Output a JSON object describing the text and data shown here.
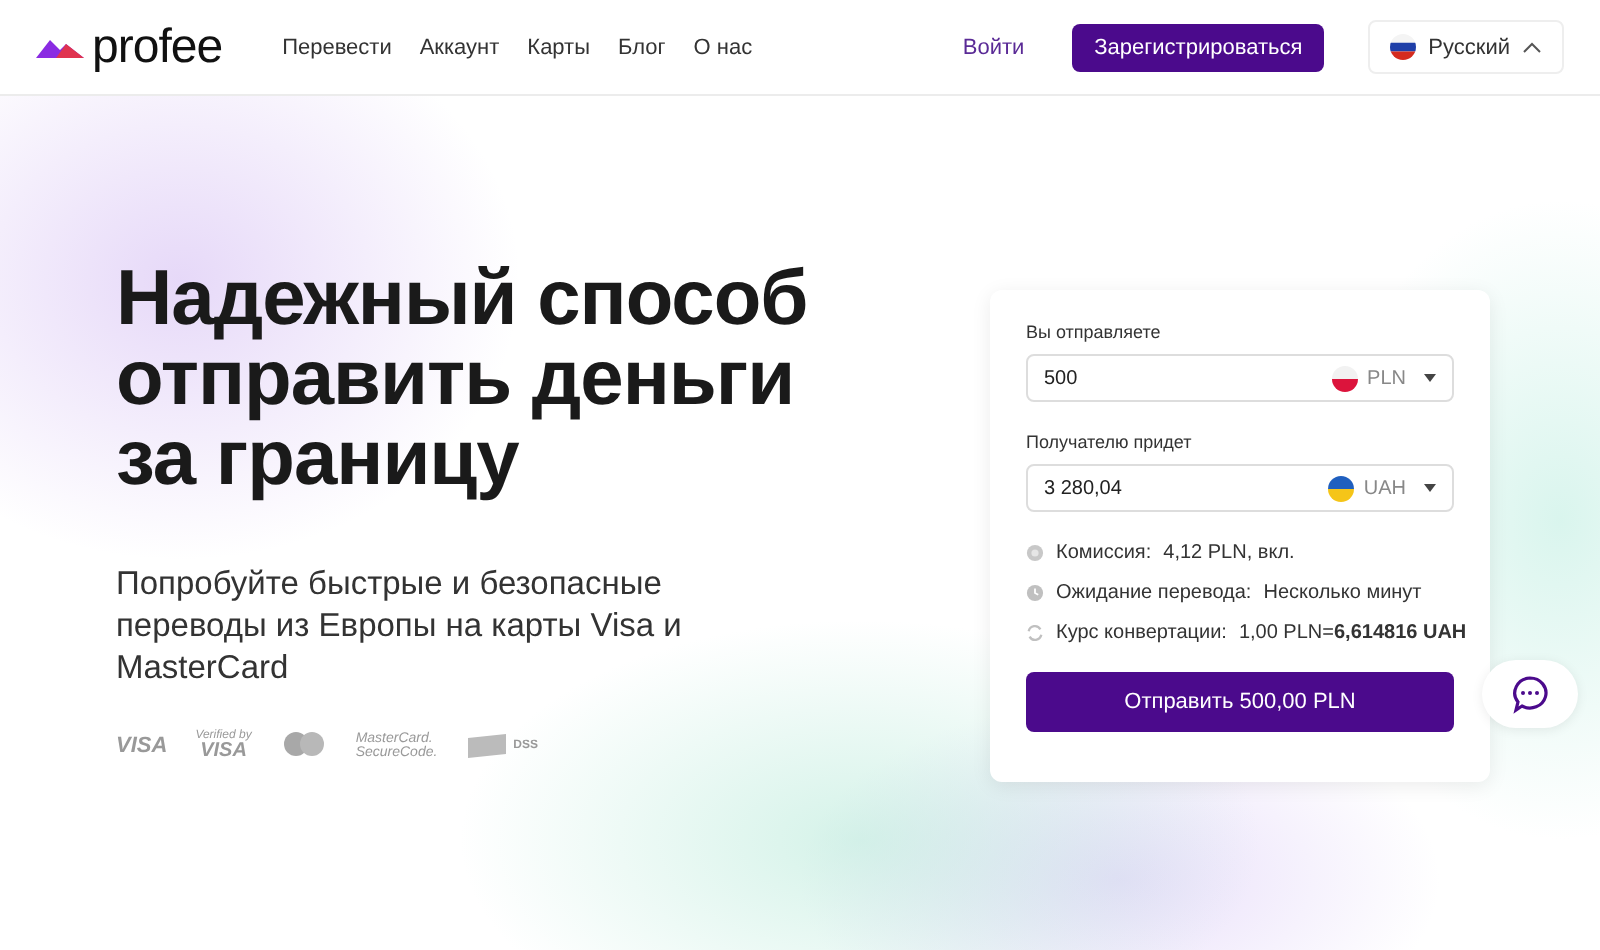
{
  "header": {
    "logo": "profee",
    "nav": [
      "Перевести",
      "Аккаунт",
      "Карты",
      "Блог",
      "О нас"
    ],
    "login": "Войти",
    "signup": "Зарегистрироваться",
    "language": {
      "label": "Русский",
      "expanded": true
    }
  },
  "hero": {
    "title_lines": [
      "Надежный способ",
      "отправить деньги",
      "за границу"
    ],
    "subtitle": "Попробуйте быстрые и безопасные переводы из Европы на карты Visa и MasterCard",
    "badges": [
      {
        "kind": "visa",
        "lines": [
          "VISA"
        ]
      },
      {
        "kind": "verified",
        "lines": [
          "Verified by",
          "VISA"
        ]
      },
      {
        "kind": "mastercard"
      },
      {
        "kind": "securecode",
        "lines": [
          "MasterCard.",
          "SecureCode."
        ]
      },
      {
        "kind": "pci",
        "lines": [
          "DSS"
        ]
      }
    ]
  },
  "calculator": {
    "send": {
      "label": "Вы отправляете",
      "value": "500",
      "currency": "PLN",
      "kind": "pl"
    },
    "receive": {
      "label": "Получателю придет",
      "value": "3 280,04",
      "currency": "UAH",
      "kind": "ua"
    },
    "info": [
      {
        "kind": "fee",
        "label": "Комиссия:",
        "value": "4,12 PLN, вкл."
      },
      {
        "kind": "time",
        "label": "Ожидание перевода:",
        "value": "Несколько минут"
      },
      {
        "kind": "rate",
        "label": "Курс конвертации:",
        "value": "1,00 PLN=**6,614816 UAH**"
      }
    ],
    "submit": "Отправить 500,00 PLN"
  }
}
